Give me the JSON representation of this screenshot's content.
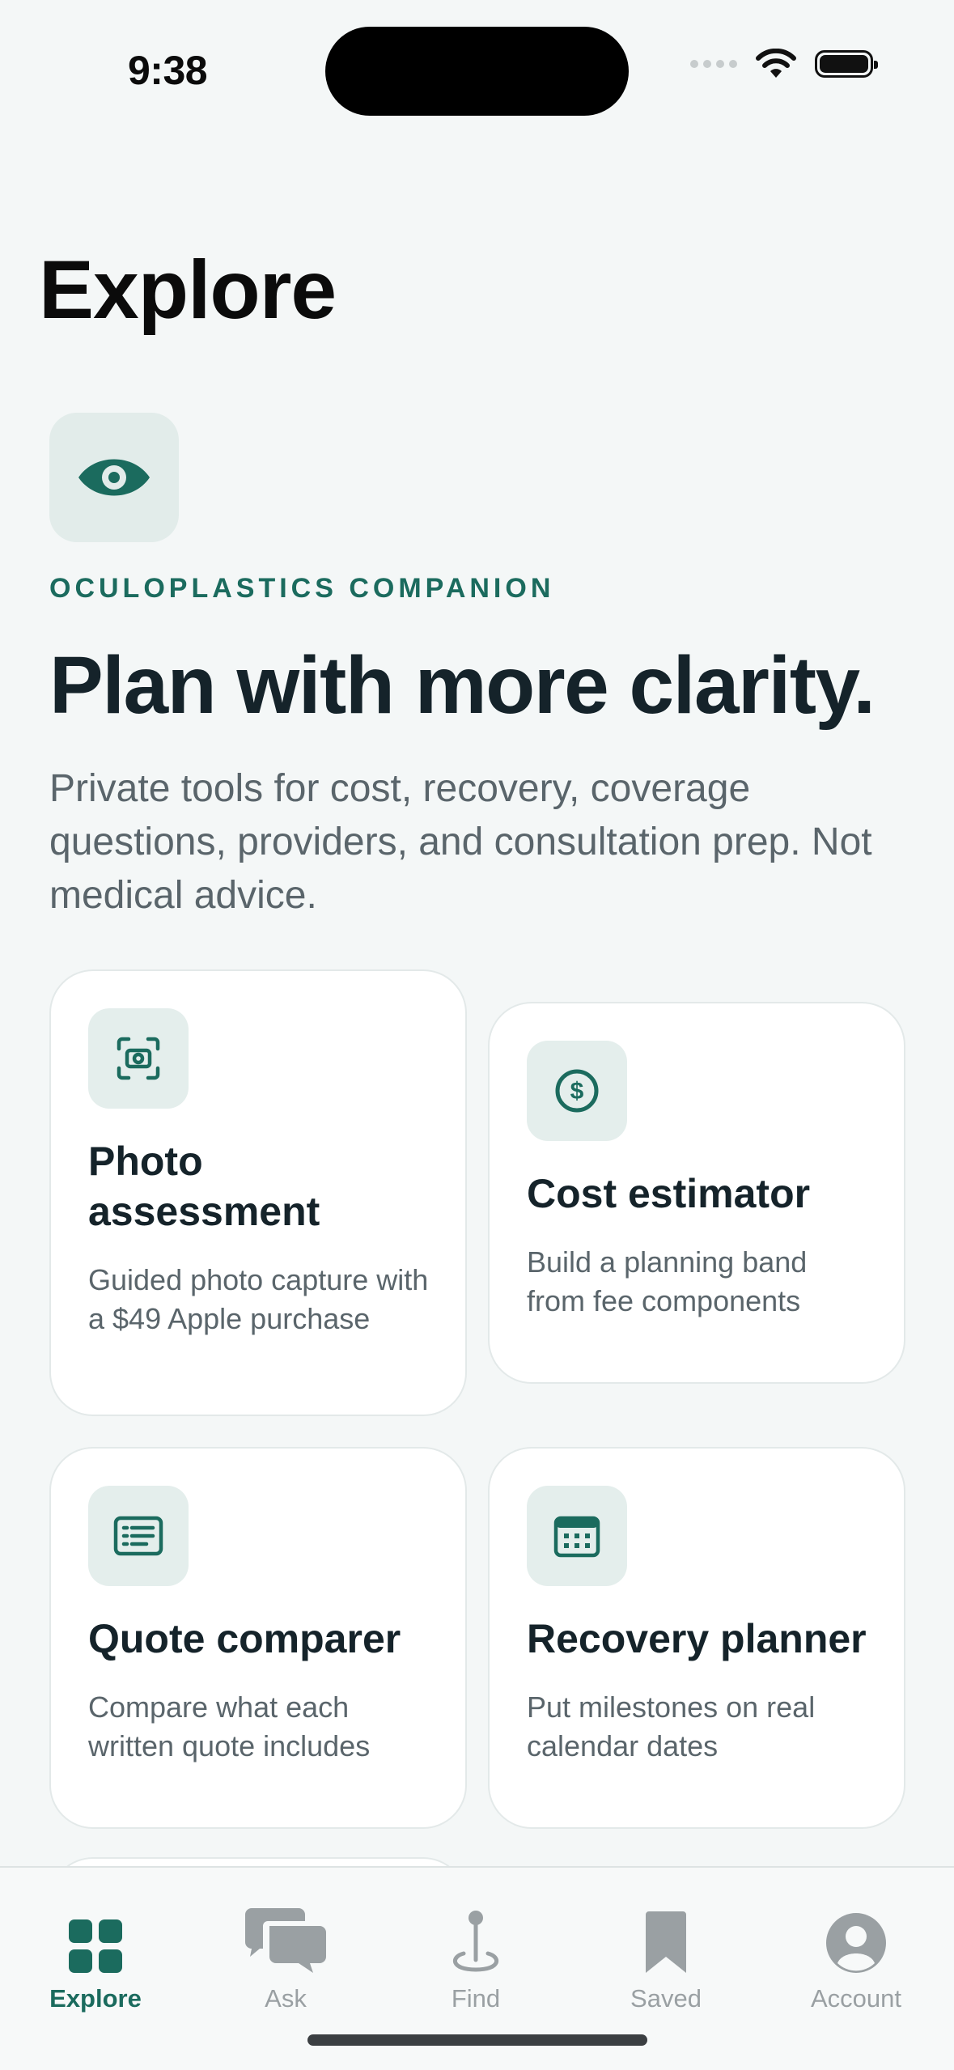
{
  "status_bar": {
    "time": "9:38"
  },
  "page": {
    "title": "Explore"
  },
  "hero": {
    "eyebrow": "OCULOPLASTICS COMPANION",
    "headline": "Plan with more clarity.",
    "subtext": "Private tools for cost, recovery, coverage questions, providers, and consultation prep. Not medical advice."
  },
  "cards": [
    {
      "title": "Photo assessment",
      "description": "Guided photo capture with a $49 Apple purchase",
      "icon": "camera-scan-icon"
    },
    {
      "title": "Cost estimator",
      "description": "Build a planning band from fee components",
      "icon": "dollar-circle-icon"
    },
    {
      "title": "Quote comparer",
      "description": "Compare what each written quote includes",
      "icon": "document-list-icon"
    },
    {
      "title": "Recovery planner",
      "description": "Put milestones on real calendar dates",
      "icon": "calendar-icon"
    }
  ],
  "tabbar": {
    "items": [
      {
        "label": "Explore",
        "icon": "grid-icon",
        "active": true
      },
      {
        "label": "Ask",
        "icon": "chat-bubbles-icon",
        "active": false
      },
      {
        "label": "Find",
        "icon": "map-pin-icon",
        "active": false
      },
      {
        "label": "Saved",
        "icon": "bookmark-icon",
        "active": false
      },
      {
        "label": "Account",
        "icon": "person-circle-icon",
        "active": false
      }
    ]
  },
  "colors": {
    "accent": "#1b6b5e",
    "background": "#f4f7f7",
    "tile": "#e4eeec",
    "inactive": "#9aa0a3"
  }
}
